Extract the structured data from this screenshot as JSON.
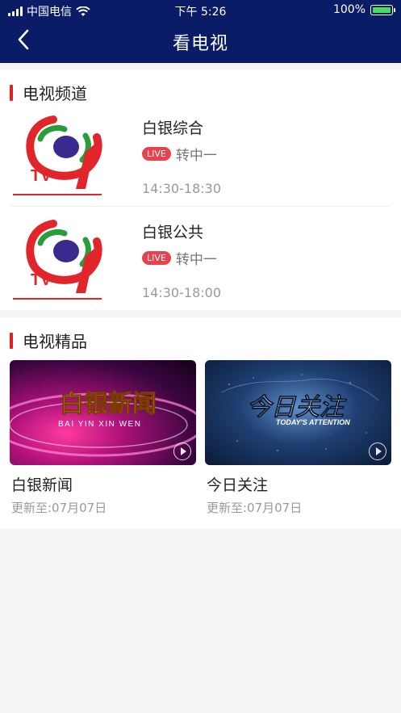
{
  "status_bar": {
    "carrier": "中国电信",
    "time": "下午 5:26",
    "battery": "100%"
  },
  "nav": {
    "title": "看电视"
  },
  "channels_section": {
    "title": "电视频道",
    "channels": [
      {
        "name": "白银综合",
        "live_badge": "LIVE",
        "program": "转中一",
        "time": "14:30-18:30",
        "logo_text": "TV"
      },
      {
        "name": "白银公共",
        "live_badge": "LIVE",
        "program": "转中一",
        "time": "14:30-18:00",
        "logo_text": "TV"
      }
    ]
  },
  "featured_section": {
    "title": "电视精品",
    "items": [
      {
        "title": "白银新闻",
        "updated": "更新至:07月07日",
        "thumb_title": "白银新闻",
        "thumb_subtitle": "BAI YIN XIN WEN"
      },
      {
        "title": "今日关注",
        "updated": "更新至:07月07日",
        "thumb_title": "今日关注",
        "thumb_subtitle": "TODAY'S ATTENTION"
      }
    ]
  },
  "colors": {
    "nav_bg": "#0b1c67",
    "accent_red": "#e02020",
    "live_badge": "#e8424f"
  }
}
